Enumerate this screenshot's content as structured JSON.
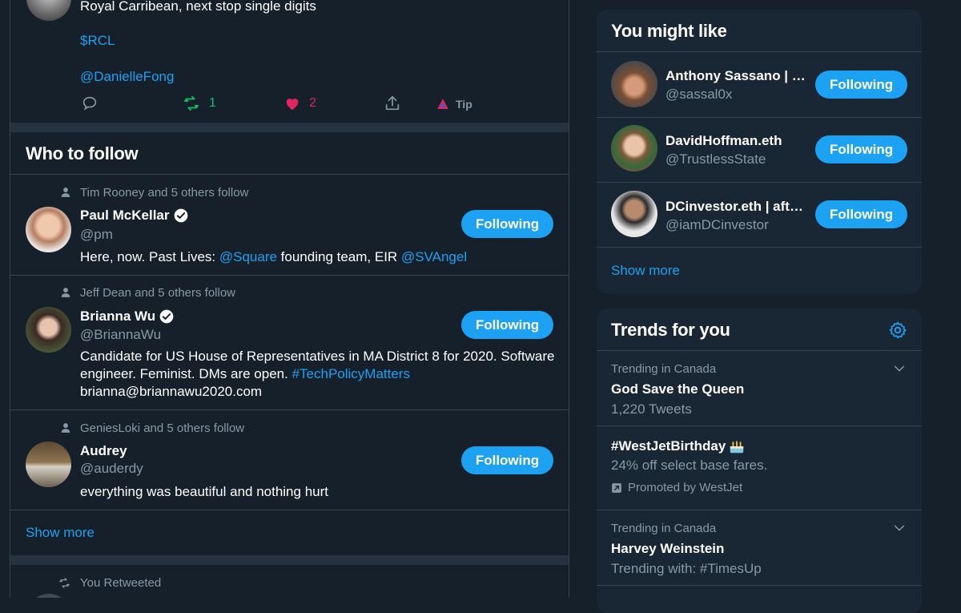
{
  "tweet": {
    "line1": "Royal Carribean, next stop single digits",
    "cashtag": "$RCL",
    "mention": "@DanielleFong",
    "retweets": "1",
    "likes": "2",
    "tip": "Tip"
  },
  "who_to_follow": {
    "title": "Who to follow",
    "people": [
      {
        "social": "Tim Rooney and 5 others follow",
        "name": "Paul McKellar",
        "handle": "@pm",
        "bio_pre": "Here, now. Past Lives: ",
        "bio_link1": "@Square",
        "bio_mid": " founding team, EIR ",
        "bio_link2": "@SVAngel",
        "button": "Following"
      },
      {
        "social": "Jeff Dean and 5 others follow",
        "name": "Brianna Wu",
        "handle": "@BriannaWu",
        "bio_pre": "Candidate for US House of Representatives in MA District 8 for 2020. Software engineer. Feminist. DMs are open. ",
        "bio_link1": "#TechPolicyMatters",
        "bio_post": "brianna@briannawu2020.com",
        "button": "Following"
      },
      {
        "social": "GeniesLoki and 5 others follow",
        "name": "Audrey",
        "handle": "@auderdy",
        "bio_pre": "everything was beautiful and nothing hurt",
        "button": "Following"
      }
    ],
    "show_more": "Show more"
  },
  "retweet_header": "You Retweeted",
  "you_might_like": {
    "title": "You might like",
    "people": [
      {
        "name": "Anthony Sassano | …",
        "handle": "@sassal0x",
        "button": "Following"
      },
      {
        "name": "DavidHoffman.eth",
        "handle": "@TrustlessState",
        "button": "Following"
      },
      {
        "name": "DCinvestor.eth | aft…",
        "handle": "@iamDCinvestor",
        "button": "Following"
      }
    ],
    "show_more": "Show more"
  },
  "trends": {
    "title": "Trends for you",
    "items": [
      {
        "context": "Trending in Canada",
        "name": "God Save the Queen",
        "sub": "1,220 Tweets"
      },
      {
        "name": "#WestJetBirthday",
        "sub": "24% off select base fares.",
        "promoted": "Promoted by WestJet"
      },
      {
        "context": "Trending in Canada",
        "name": "Harvey Weinstein",
        "sub": "Trending with: #TimesUp"
      }
    ]
  },
  "colors": {
    "background": "#15202b",
    "card": "#192734",
    "accent": "#1da1f2",
    "muted": "#8899a6",
    "retweet_green": "#17bf63",
    "like_red": "#e0245e"
  },
  "icons": [
    "reply-icon",
    "retweet-icon",
    "like-icon",
    "share-icon",
    "tip-icon",
    "person-icon",
    "verified-icon",
    "gear-icon",
    "chevron-down-icon",
    "promoted-icon",
    "cake-icon"
  ]
}
